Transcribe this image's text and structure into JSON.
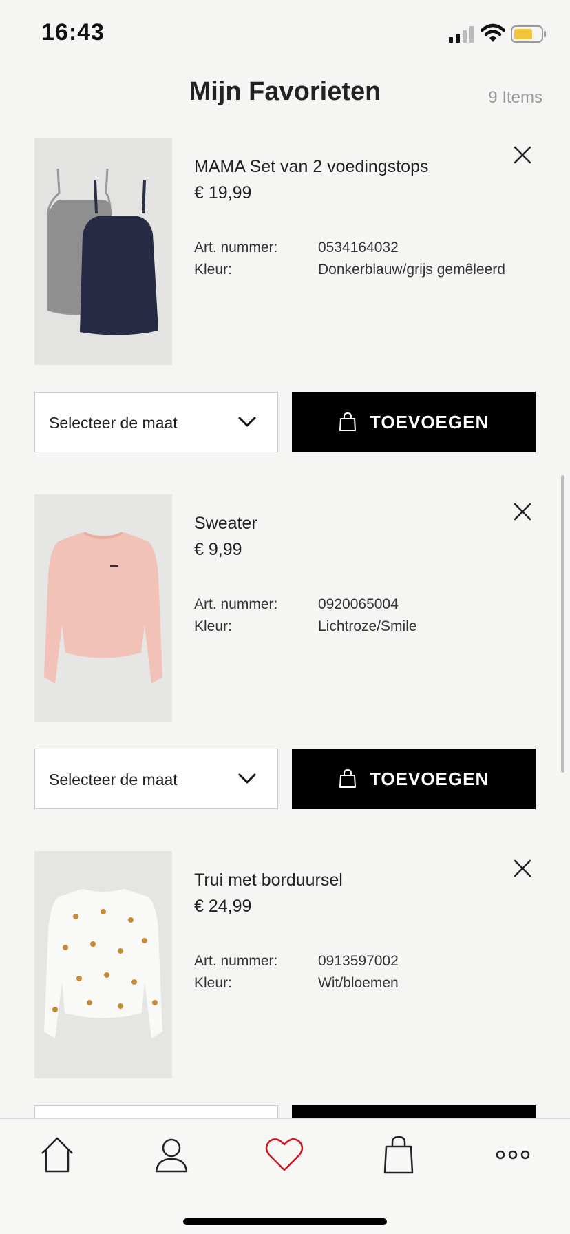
{
  "status_bar": {
    "time": "16:43"
  },
  "header": {
    "title": "Mijn Favorieten",
    "item_count": "9 Items"
  },
  "labels": {
    "article_number": "Art. nummer:",
    "color": "Kleur:",
    "size_select": "Selecteer de maat",
    "add_to_bag": "TOEVOEGEN"
  },
  "products": [
    {
      "name": "MAMA Set van 2 voedingstops",
      "price": "€ 19,99",
      "article_number": "0534164032",
      "color": "Donkerblauw/grijs gemêleerd"
    },
    {
      "name": "Sweater",
      "price": "€ 9,99",
      "article_number": "0920065004",
      "color": "Lichtroze/Smile"
    },
    {
      "name": "Trui met borduursel",
      "price": "€ 24,99",
      "article_number": "0913597002",
      "color": "Wit/bloemen"
    }
  ],
  "tab_bar": {
    "items": [
      "home-icon",
      "profile-icon",
      "heart-icon",
      "bag-icon",
      "more-icon"
    ],
    "active": "heart-icon",
    "active_color": "#d3131e"
  },
  "colors": {
    "background": "#f5f5f3",
    "button_primary": "#000000",
    "muted_text": "#9a9a9a"
  }
}
